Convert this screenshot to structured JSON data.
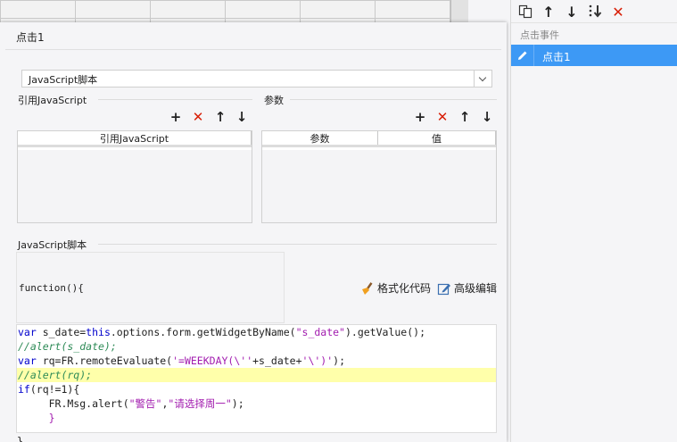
{
  "dialog": {
    "title": "点击1",
    "script_type": {
      "selected": "JavaScript脚本"
    },
    "ref_js": {
      "section_label": "引用JavaScript",
      "columns": [
        "引用JavaScript"
      ]
    },
    "params": {
      "section_label": "参数",
      "columns": [
        "参数",
        "值"
      ]
    },
    "script_section_label": "JavaScript脚本",
    "function_header": "function(){",
    "format_code_label": "格式化代码",
    "advanced_edit_label": "高级编辑",
    "code_lines": [
      "var s_date=this.options.form.getWidgetByName(\"s_date\").getValue();",
      "//alert(s_date);",
      "var rq=FR.remoteEvaluate('=WEEKDAY(\\''+s_date+'\\')');",
      "//alert(rq);",
      "if(rq!=1){",
      "     FR.Msg.alert(\"警告\",\"请选择周一\");",
      "     }"
    ],
    "closing_brace": "}"
  },
  "events_panel": {
    "caption": "点击事件",
    "items": [
      {
        "label": "点击1",
        "selected": true
      }
    ]
  },
  "colors": {
    "accent": "#3d99f5",
    "delete": "#d81e06",
    "highlight": "#ffffaa"
  },
  "icons": [
    "copy-icon",
    "move-up-icon",
    "move-down-icon",
    "sort-icon",
    "delete-icon",
    "add-icon",
    "edit-icon",
    "broom-icon",
    "advanced-edit-icon",
    "dropdown-arrow-icon"
  ]
}
